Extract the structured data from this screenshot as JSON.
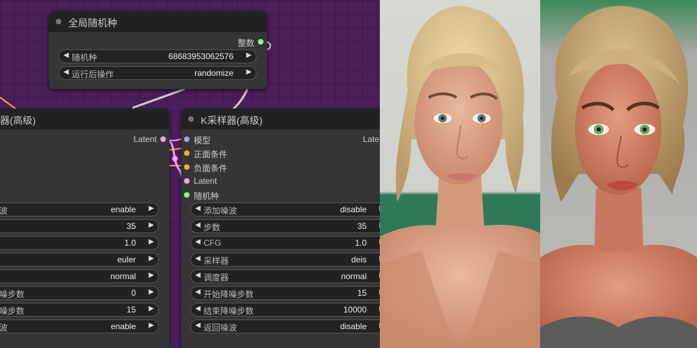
{
  "seed_node": {
    "title": "全局随机种",
    "output_label": "整数",
    "widgets": [
      {
        "label": "随机种",
        "value": "68683953062576"
      },
      {
        "label": "运行后操作",
        "value": "randomize"
      }
    ]
  },
  "left_node": {
    "title_partial": "器(高级)",
    "output_label": "Latent",
    "widgets": [
      {
        "label": "波",
        "value": "enable"
      },
      {
        "label": "",
        "value": "35"
      },
      {
        "label": "",
        "value": "1.0"
      },
      {
        "label": "",
        "value": "euler"
      },
      {
        "label": "",
        "value": "normal"
      },
      {
        "label": "噪步数",
        "value": "0"
      },
      {
        "label": "噪步数",
        "value": "15"
      },
      {
        "label": "波",
        "value": "enable"
      }
    ]
  },
  "right_node": {
    "title": "K采样器(高级)",
    "output_label_partial": "Late",
    "inputs": [
      {
        "label": "模型",
        "color": "#a3a3d9"
      },
      {
        "label": "正面条件",
        "color": "#ffa931"
      },
      {
        "label": "负面条件",
        "color": "#ffa931"
      },
      {
        "label": "Latent",
        "color": "#ff9cf9"
      },
      {
        "label": "随机种",
        "color": "#7eff7e"
      }
    ],
    "widgets": [
      {
        "label": "添加噪波",
        "value": "disable"
      },
      {
        "label": "步数",
        "value": "35"
      },
      {
        "label": "CFG",
        "value": "1.0"
      },
      {
        "label": "采样器",
        "value": "deis"
      },
      {
        "label": "调度器",
        "value": "normal"
      },
      {
        "label": "开始降噪步数",
        "value": "15"
      },
      {
        "label": "结束降噪步数",
        "value": "10000"
      },
      {
        "label": "返回噪波",
        "value": "disable"
      }
    ]
  },
  "icons": {
    "left_arrow": "◀",
    "right_arrow": "▶"
  },
  "colors": {
    "canvas_bg": "#4a1f5a",
    "node_bg": "#353535",
    "title_bg": "#222222",
    "latent_link": "#ff9cf9",
    "conditioning_link": "#ffa931",
    "int_link": "#7eff7e"
  },
  "images": [
    {
      "subject": "photorealistic-portrait"
    },
    {
      "subject": "3d-render-portrait"
    }
  ]
}
